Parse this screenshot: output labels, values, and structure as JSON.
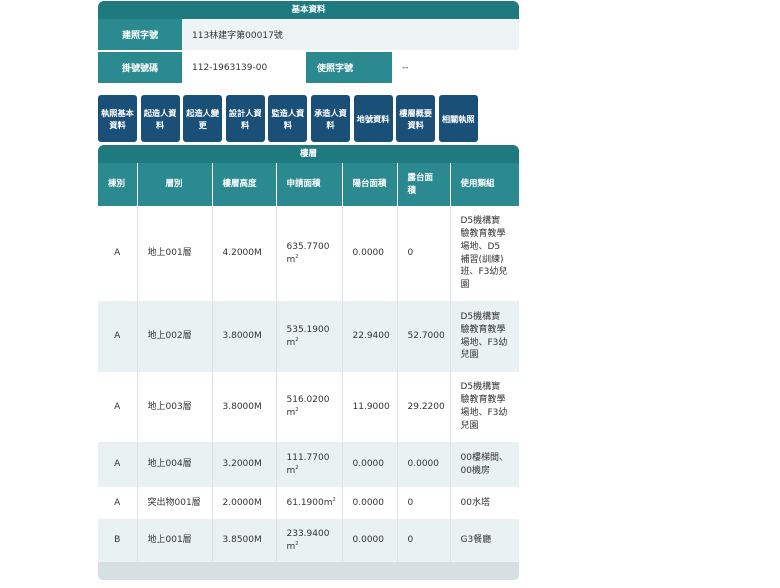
{
  "basic": {
    "title": "基本資料",
    "permit_label": "建照字號",
    "permit_value": "113林建字第00017號",
    "reg_label": "掛號號碼",
    "reg_value": "112-1963139-00",
    "use_label": "使照字號",
    "use_value": "--"
  },
  "tabs": [
    "執照基本資料",
    "起造人資料",
    "起造人變更",
    "設計人資料",
    "監造人資料",
    "承造人資料",
    "地號資料",
    "樓層概要資料",
    "相關執照"
  ],
  "floors": {
    "title": "樓層",
    "headers": [
      "棟別",
      "層別",
      "樓層高度",
      "申請面積",
      "陽台面積",
      "露台面積",
      "使用類組"
    ],
    "area_unit": "m",
    "area_unit_sup": "2",
    "rows": [
      {
        "building": "A",
        "floor": "地上001層",
        "height": "4.2000M",
        "area": "635.7700",
        "balcony": "0.0000",
        "terrace": "0",
        "usage": "D5機構實驗教育教學場地、D5補習(訓練)班、F3幼兒園"
      },
      {
        "building": "A",
        "floor": "地上002層",
        "height": "3.8000M",
        "area": "535.1900",
        "balcony": "22.9400",
        "terrace": "52.7000",
        "usage": "D5機構實驗教育教學場地、F3幼兒園"
      },
      {
        "building": "A",
        "floor": "地上003層",
        "height": "3.8000M",
        "area": "516.0200",
        "balcony": "11.9000",
        "terrace": "29.2200",
        "usage": "D5機構實驗教育教學場地、F3幼兒園"
      },
      {
        "building": "A",
        "floor": "地上004層",
        "height": "3.2000M",
        "area": "111.7700",
        "balcony": "0.0000",
        "terrace": "0.0000",
        "usage": "00樓梯間、00機房"
      },
      {
        "building": "A",
        "floor": "突出物001層",
        "height": "2.0000M",
        "area": "61.1900",
        "balcony": "0.0000",
        "terrace": "0",
        "usage": "00水塔"
      },
      {
        "building": "B",
        "floor": "地上001層",
        "height": "3.8500M",
        "area": "233.9400",
        "balcony": "0.0000",
        "terrace": "0",
        "usage": "G3餐廳"
      }
    ]
  }
}
